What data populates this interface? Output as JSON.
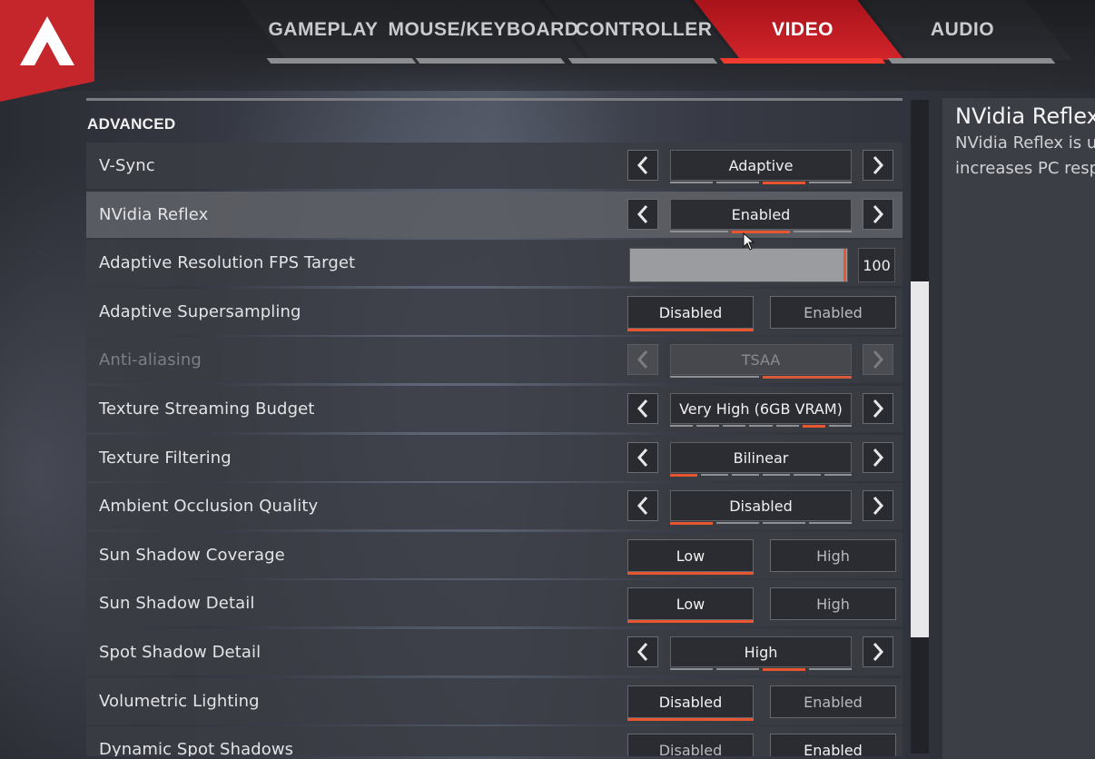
{
  "tabs": [
    {
      "label": "GAMEPLAY",
      "active": false
    },
    {
      "label": "MOUSE/KEYBOARD",
      "active": false
    },
    {
      "label": "CONTROLLER",
      "active": false
    },
    {
      "label": "VIDEO",
      "active": true
    },
    {
      "label": "AUDIO",
      "active": false
    }
  ],
  "section_title": "ADVANCED",
  "settings": [
    {
      "label": "V-Sync",
      "type": "cycle",
      "value": "Adaptive",
      "segments": 4,
      "selected_segment": 2
    },
    {
      "label": "NVidia Reflex",
      "type": "cycle",
      "value": "Enabled",
      "segments": 3,
      "selected_segment": 1,
      "selected_row": true
    },
    {
      "label": "Adaptive Resolution FPS Target",
      "type": "slider",
      "value": "100",
      "fill_fraction": 1.0
    },
    {
      "label": "Adaptive Supersampling",
      "type": "toggle",
      "options": [
        "Disabled",
        "Enabled"
      ],
      "selected": 0
    },
    {
      "label": "Anti-aliasing",
      "type": "cycle",
      "value": "TSAA",
      "segments": 2,
      "selected_segment": 1,
      "disabled": true
    },
    {
      "label": "Texture Streaming Budget",
      "type": "cycle",
      "value": "Very High (6GB VRAM)",
      "segments": 7,
      "selected_segment": 5
    },
    {
      "label": "Texture Filtering",
      "type": "cycle",
      "value": "Bilinear",
      "segments": 6,
      "selected_segment": 0
    },
    {
      "label": "Ambient Occlusion Quality",
      "type": "cycle",
      "value": "Disabled",
      "segments": 4,
      "selected_segment": 0
    },
    {
      "label": "Sun Shadow Coverage",
      "type": "toggle",
      "options": [
        "Low",
        "High"
      ],
      "selected": 0
    },
    {
      "label": "Sun Shadow Detail",
      "type": "toggle",
      "options": [
        "Low",
        "High"
      ],
      "selected": 0
    },
    {
      "label": "Spot Shadow Detail",
      "type": "cycle",
      "value": "High",
      "segments": 4,
      "selected_segment": 2
    },
    {
      "label": "Volumetric Lighting",
      "type": "toggle",
      "options": [
        "Disabled",
        "Enabled"
      ],
      "selected": 0
    },
    {
      "label": "Dynamic Spot Shadows",
      "type": "toggle",
      "options": [
        "Disabled",
        "Enabled"
      ],
      "selected": 1
    }
  ],
  "info": {
    "title": "NVidia Reflex",
    "description": "NVidia Reflex is us\nincreases PC resp"
  },
  "colors": {
    "accent": "#e8562f",
    "brand_red": "#c4262b",
    "active_tab": "#d2242b"
  },
  "icons": {
    "logo": "apex-logo-icon",
    "prev": "chevron-left-icon",
    "next": "chevron-right-icon",
    "cursor": "mouse-pointer-icon"
  }
}
